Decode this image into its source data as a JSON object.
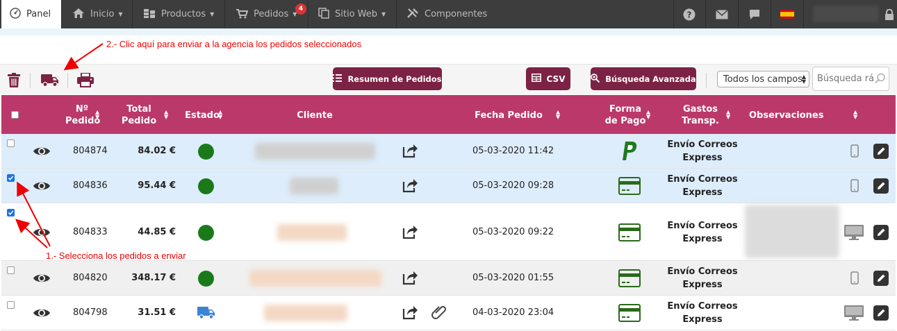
{
  "nav": {
    "panel": "Panel",
    "items": [
      {
        "label": "Inicio"
      },
      {
        "label": "Productos"
      },
      {
        "label": "Pedidos",
        "badge": "4"
      },
      {
        "label": "Sitio Web"
      },
      {
        "label": "Componentes"
      }
    ]
  },
  "annotations": {
    "top": "2.- Clic aquí para enviar a la agencia los pedidos seleccionados",
    "bottom": "1.- Selecciona los pedidos a enviar"
  },
  "toolbar": {
    "resumen": "Resumen de Pedidos",
    "csv": "CSV",
    "busqueda": "Búsqueda Avanzada",
    "select_value": "Todos los campos",
    "search_placeholder": "Búsqueda rá"
  },
  "table": {
    "headers": {
      "num1": "Nº",
      "num2": "Pedido",
      "total1": "Total",
      "total2": "Pedido",
      "estado": "Estado",
      "cliente": "Cliente",
      "fecha": "Fecha Pedido",
      "forma1": "Forma",
      "forma2": "de Pago",
      "gastos1": "Gastos",
      "gastos2": "Transp.",
      "obs": "Observaciones"
    },
    "rows": [
      {
        "id": "804874",
        "total": "84.02 €",
        "estado": "green-dot",
        "fecha": "05-03-2020 11:42",
        "pago": "paypal-icon",
        "envio1": "Envío Correos",
        "envio2": "Express",
        "device": "mobile-icon",
        "checked": false
      },
      {
        "id": "804836",
        "total": "95.44 €",
        "estado": "green-dot",
        "fecha": "05-03-2020 09:28",
        "pago": "credit-card-icon",
        "envio1": "Envío Correos",
        "envio2": "Express",
        "device": "mobile-icon",
        "checked": true
      },
      {
        "id": "804833",
        "total": "44.85 €",
        "estado": "green-dot",
        "fecha": "05-03-2020 09:22",
        "pago": "credit-card-icon",
        "envio1": "Envío Correos",
        "envio2": "Express",
        "device": "desktop-icon",
        "checked": true
      },
      {
        "id": "804820",
        "total": "348.17 €",
        "estado": "green-dot",
        "fecha": "05-03-2020 01:55",
        "pago": "credit-card-icon",
        "envio1": "Envío Correos",
        "envio2": "Express",
        "device": "mobile-icon",
        "checked": false
      },
      {
        "id": "804798",
        "total": "31.51 €",
        "estado": "truck-icon",
        "fecha": "04-03-2020 23:04",
        "pago": "credit-card-icon",
        "envio1": "Envío Correos",
        "envio2": "Express",
        "device": "desktop-icon",
        "checked": false
      }
    ]
  },
  "colors": {
    "accent": "#7c2244",
    "header": "#bb386a",
    "status_green": "#1a7a1a",
    "annotation": "#e00000"
  }
}
